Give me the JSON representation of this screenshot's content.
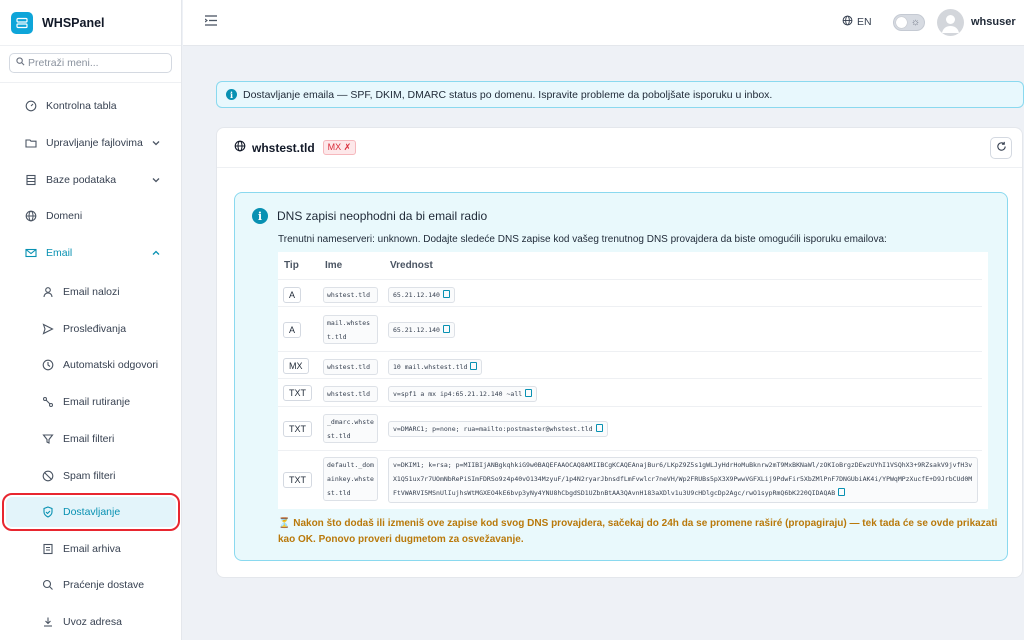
{
  "app": {
    "name": "WHSPanel"
  },
  "search": {
    "placeholder": "Pretraži meni..."
  },
  "sidebar": {
    "items": [
      {
        "label": "Kontrolna tabla"
      },
      {
        "label": "Upravljanje fajlovima"
      },
      {
        "label": "Baze podataka"
      },
      {
        "label": "Domeni"
      },
      {
        "label": "Email"
      },
      {
        "label": "Email nalozi"
      },
      {
        "label": "Prosleđivanja"
      },
      {
        "label": "Automatski odgovori"
      },
      {
        "label": "Email rutiranje"
      },
      {
        "label": "Email filteri"
      },
      {
        "label": "Spam filteri"
      },
      {
        "label": "Dostavljanje"
      },
      {
        "label": "Email arhiva"
      },
      {
        "label": "Praćenje dostave"
      },
      {
        "label": "Uvoz adresa"
      }
    ]
  },
  "topbar": {
    "language": "EN",
    "username": "whsuser"
  },
  "banner": {
    "text": "Dostavljanje emaila — SPF, DKIM, DMARC status po domenu. Ispravite probleme da poboljšate isporuku u inbox."
  },
  "domain_card": {
    "domain": "whstest.tld",
    "mx_badge": "MX ✗",
    "dns_title": "DNS zapisi neophodni da bi email radio",
    "dns_description": "Trenutni nameserveri: unknown. Dodajte sledeće DNS zapise kod vašeg trenutnog DNS provajdera da biste omogućili isporuku emailova:",
    "columns": {
      "type": "Tip",
      "name": "Ime",
      "value": "Vrednost"
    },
    "records": [
      {
        "type": "A",
        "name": "whstest.tld",
        "value": "65.21.12.140"
      },
      {
        "type": "A",
        "name": "mail.whstest.tld",
        "value": "65.21.12.140"
      },
      {
        "type": "MX",
        "name": "whstest.tld",
        "value": "10 mail.whstest.tld"
      },
      {
        "type": "TXT",
        "name": "whstest.tld",
        "value": "v=spf1 a mx ip4:65.21.12.140 ~all"
      },
      {
        "type": "TXT",
        "name": "_dmarc.whstest.tld",
        "value": "v=DMARC1; p=none; rua=mailto:postmaster@whstest.tld"
      },
      {
        "type": "TXT",
        "name": "default._domainkey.whstest.tld",
        "value": "v=DKIM1; k=rsa; p=MIIBIjANBgkqhkiG9w0BAQEFAAOCAQ8AMIIBCgKCAQEAnajBur6/LKpZ9Z5s1gWLJyHdrHoMuBknrw2mT9MxBKNaWl/zOKIoBrgzDEwzUYhI1VSQhX3+9RZsakV9jvfH3vX1Q51ux7r7UOmNbRePiSImFDRSo9z4p40vO134MzyuF/1p4N2ryarJbnsdfLmFvwlcr7neVH/Wp2FRUBs5pX3X9PwwVGFXLij9PdwFir5XbZMlPnF7DNGUbiAK4i/YPWqMPzXucfE+D9JrbCUd0MFtVWARVI5MSnUlIujhsWtMGXEO4kE6bvp3yNy4YNU8hCbgdSD1UZbnBtAA3QAvnH183aXDlv1u3U9cHDlgcDp2Agc/rwO1sypRmQ6bK220QIDAQAB"
      }
    ],
    "warning": "⏳ Nakon što dodaš ili izmeniš ove zapise kod svog DNS provajdera, sačekaj do 24h da se promene raširé (propagiraju) — tek tada će se ovde prikazati kao OK. Ponovo proveri dugmetom za osvežavanje."
  }
}
